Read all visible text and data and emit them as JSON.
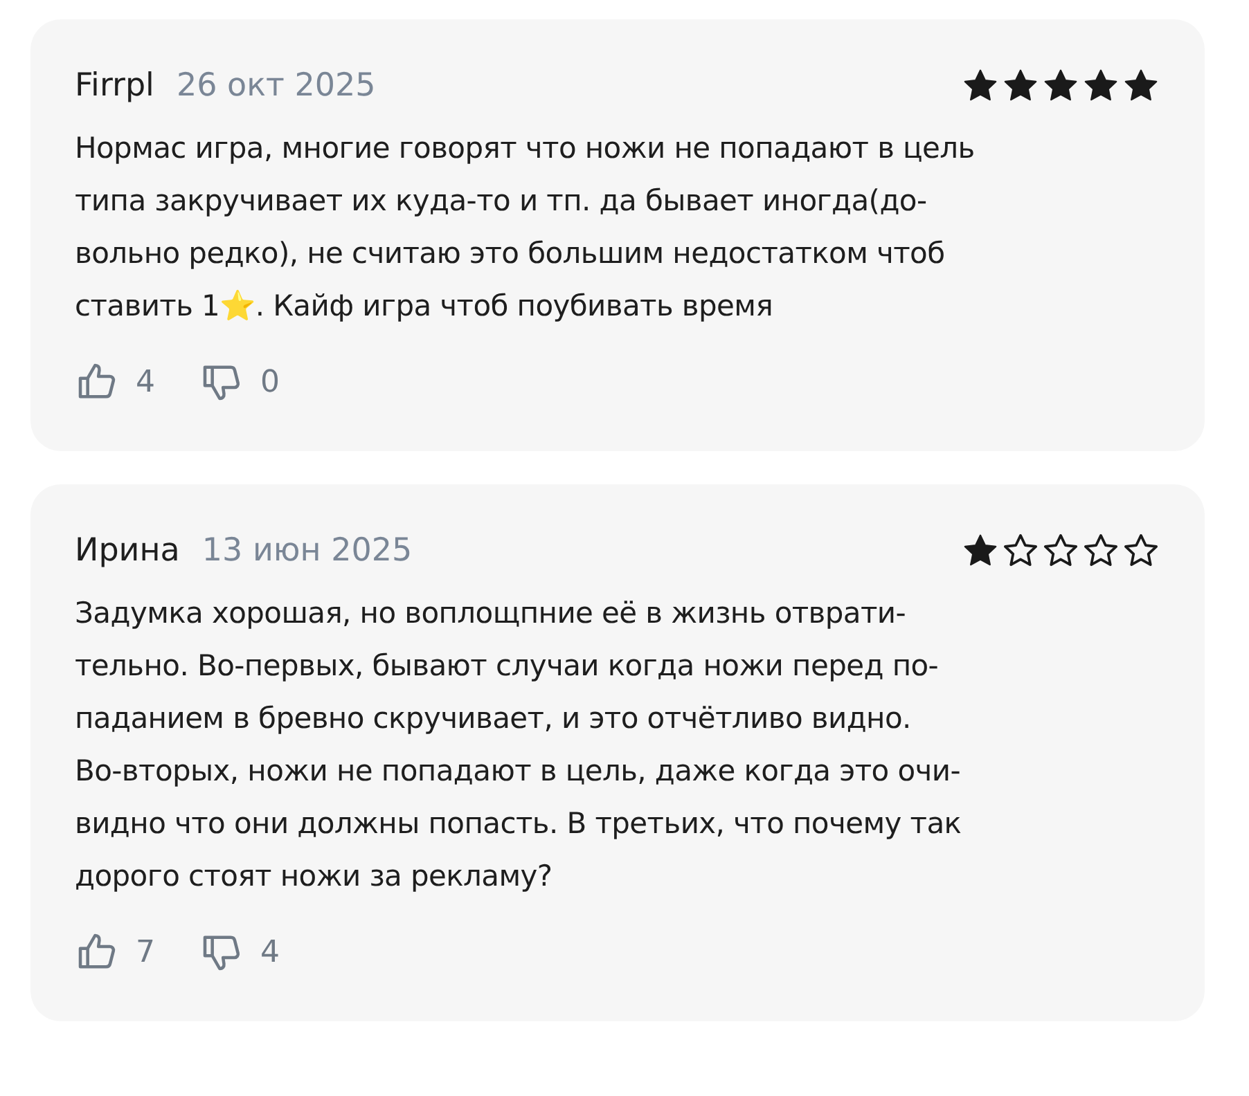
{
  "reviews": [
    {
      "author": "Firrpl",
      "date": "26 окт 2025",
      "stars": 5,
      "text": "Нормас игра, многие говорят что ножи не попадают в цель\nтипа закручивает их куда-то и тп. да бывает иногда(до-\nвольно редко), не считаю это большим недостатком чтоб\nставить 1⭐. Кайф игра чтоб поубивать время",
      "likes": "4",
      "dislikes": "0"
    },
    {
      "author": "Ирина",
      "date": "13 июн 2025",
      "stars": 1,
      "text": "Задумка хорошая, но воплощпние её в жизнь отврати-\nтельно. Во-первых, бывают случаи когда ножи перед по-\nпаданием в бревно скручивает, и это отчётливо видно.\nВо-вторых, ножи не попадают в цель, даже когда это очи-\nвидно что они должны попасть. В третьих, что почему так\nдорого стоят ножи за рекламу?",
      "likes": "7",
      "dislikes": "4"
    }
  ]
}
